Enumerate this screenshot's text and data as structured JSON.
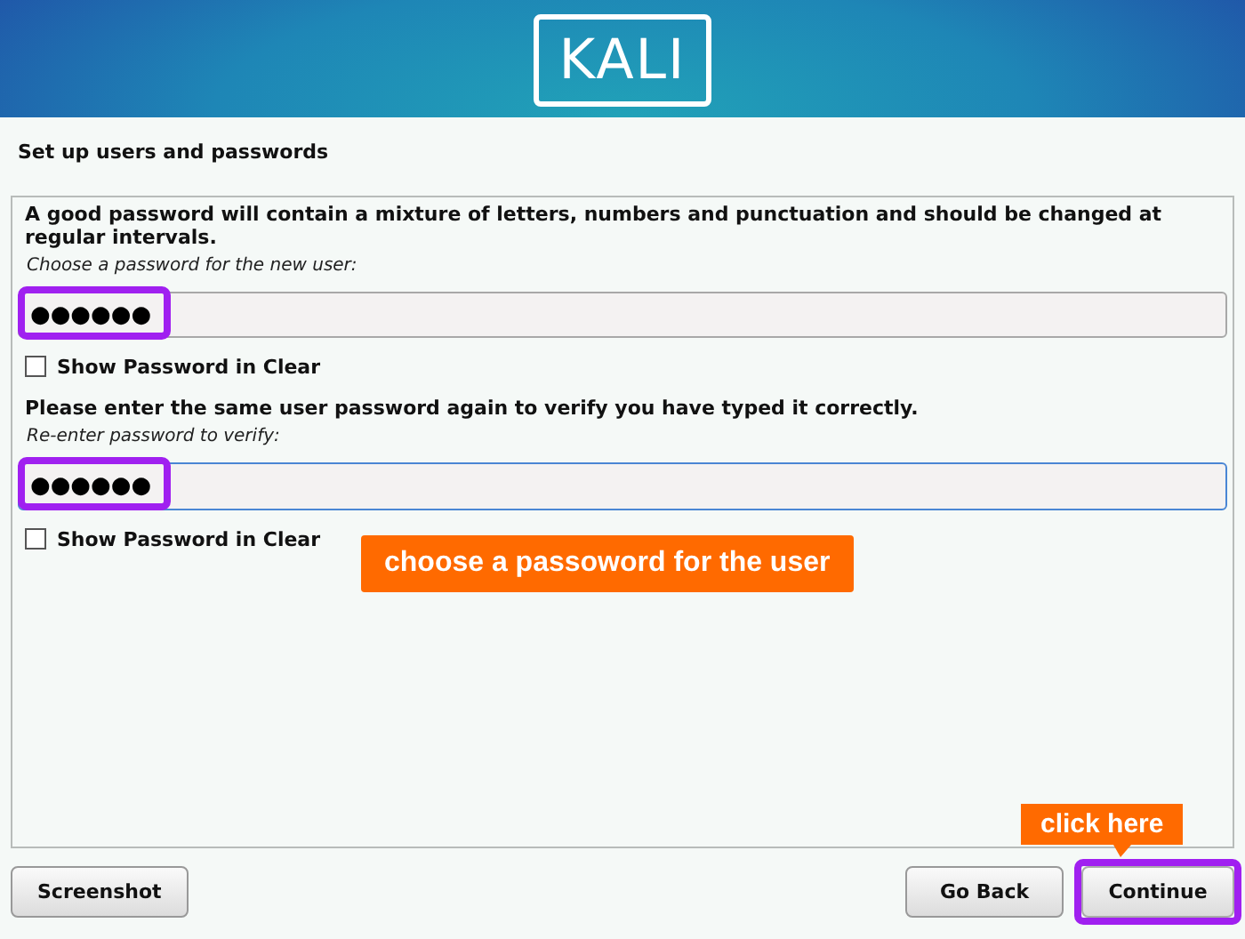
{
  "header": {
    "logo": "KALI"
  },
  "page_title": "Set up users and passwords",
  "intro": "A good password will contain a mixture of letters, numbers and punctuation and should be changed at regular intervals.",
  "fields": [
    {
      "label": "Choose a password for the new user:",
      "value": "●●●●●●",
      "focused": false,
      "highlighted": true,
      "show_clear": {
        "label": "Show Password in Clear",
        "checked": false
      }
    },
    {
      "prompt": "Please enter the same user password again to verify you have typed it correctly.",
      "label": "Re-enter password to verify:",
      "value": "●●●●●●",
      "focused": true,
      "highlighted": true,
      "show_clear": {
        "label": "Show Password in Clear",
        "checked": false
      }
    }
  ],
  "callout": "choose a passoword for the user",
  "buttons": [
    {
      "label": "Screenshot",
      "highlighted": false
    },
    {
      "label": "Go Back",
      "highlighted": false
    },
    {
      "label": "Continue",
      "highlighted": true,
      "callout": "click here"
    }
  ]
}
